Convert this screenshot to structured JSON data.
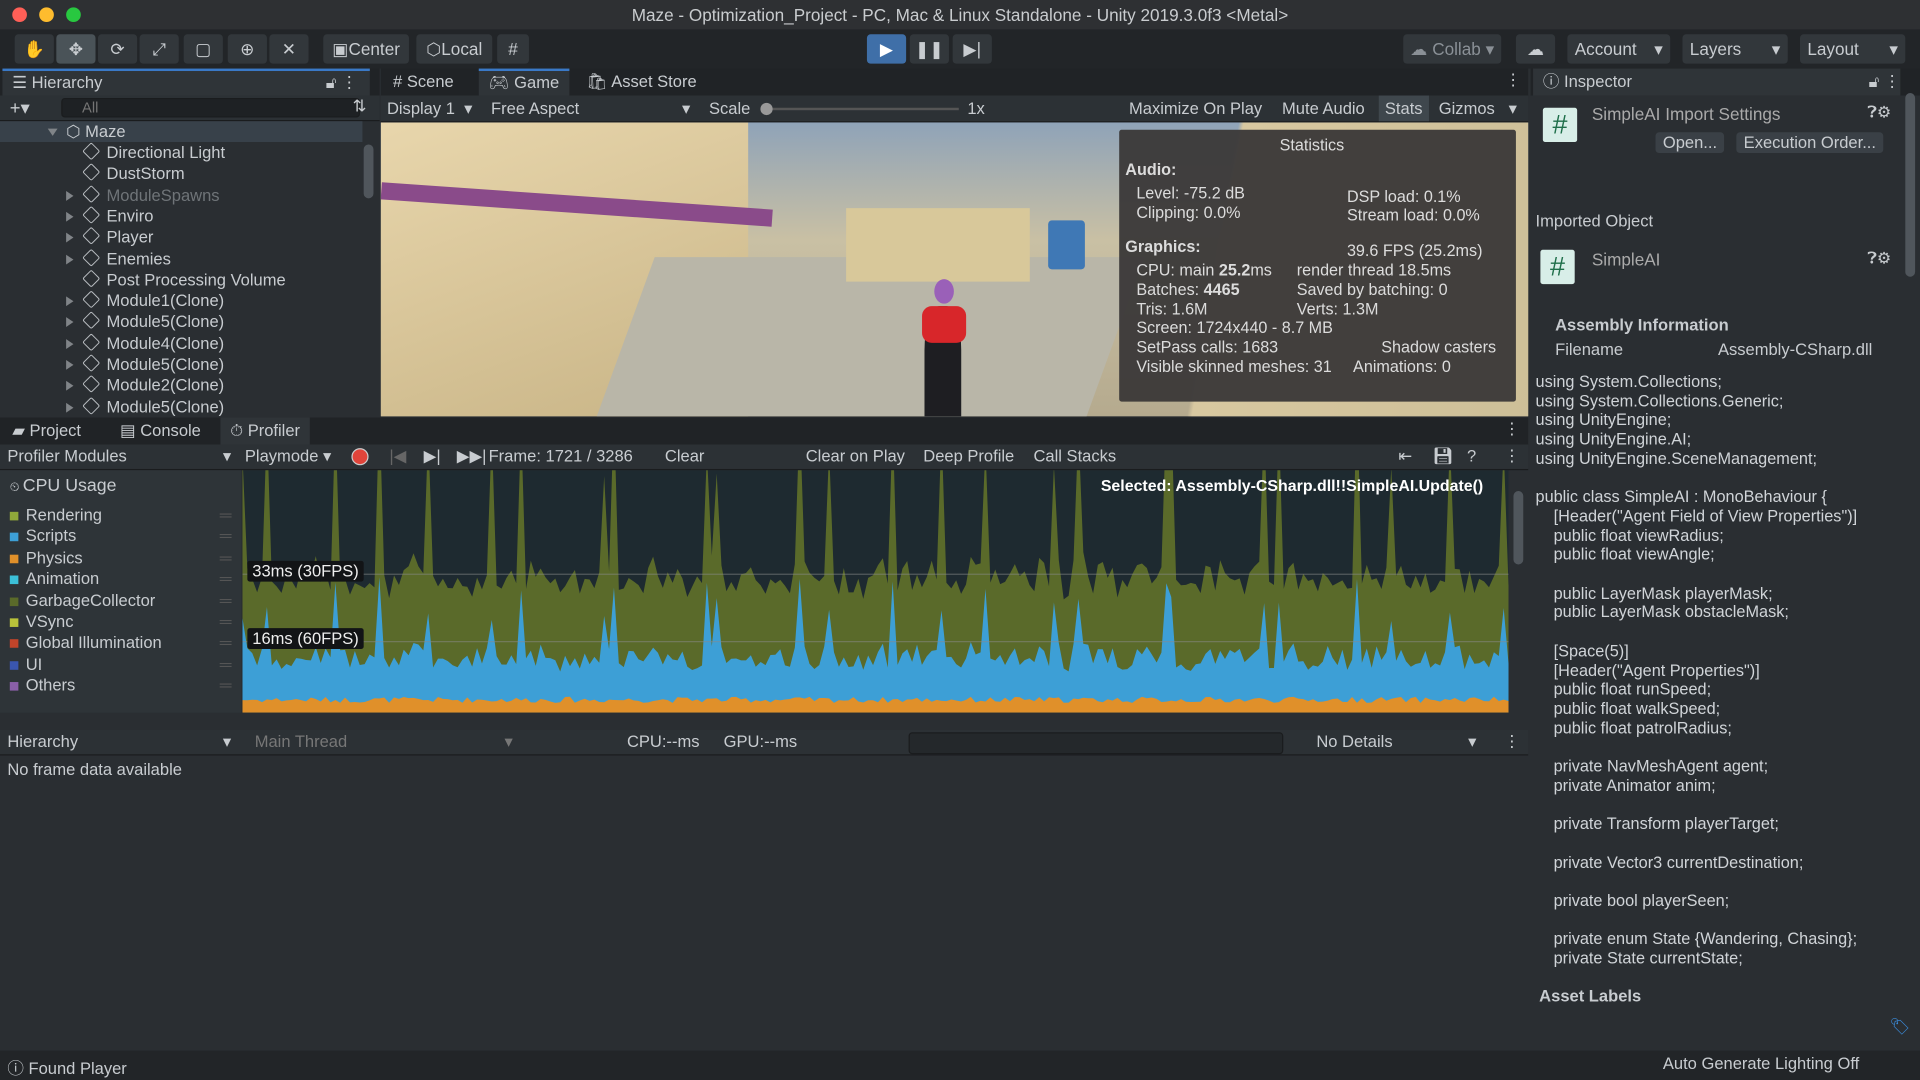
{
  "window": {
    "title": "Maze - Optimization_Project - PC, Mac & Linux Standalone - Unity 2019.3.0f3 <Metal>"
  },
  "toolbar": {
    "tools": [
      "hand-tool",
      "move-tool",
      "rotate-tool",
      "scale-tool",
      "rect-tool",
      "transform-tool",
      "custom-tool"
    ],
    "center": "Center",
    "local": "Local",
    "collab": "Collab",
    "account": "Account",
    "layers": "Layers",
    "layout": "Layout"
  },
  "hierarchy": {
    "title": "Hierarchy",
    "search_placeholder": "All",
    "scene": "Maze",
    "items": [
      {
        "label": "Directional Light",
        "expandable": false,
        "dim": false
      },
      {
        "label": "DustStorm",
        "expandable": false,
        "dim": false
      },
      {
        "label": "ModuleSpawns",
        "expandable": true,
        "dim": true
      },
      {
        "label": "Enviro",
        "expandable": true,
        "dim": false
      },
      {
        "label": "Player",
        "expandable": true,
        "dim": false
      },
      {
        "label": "Enemies",
        "expandable": true,
        "dim": false
      },
      {
        "label": "Post Processing Volume",
        "expandable": false,
        "dim": false
      },
      {
        "label": "Module1(Clone)",
        "expandable": true,
        "dim": false
      },
      {
        "label": "Module5(Clone)",
        "expandable": true,
        "dim": false
      },
      {
        "label": "Module4(Clone)",
        "expandable": true,
        "dim": false
      },
      {
        "label": "Module5(Clone)",
        "expandable": true,
        "dim": false
      },
      {
        "label": "Module2(Clone)",
        "expandable": true,
        "dim": false
      },
      {
        "label": "Module5(Clone)",
        "expandable": true,
        "dim": false
      }
    ]
  },
  "game": {
    "tabs": [
      "Scene",
      "Game",
      "Asset Store"
    ],
    "display": "Display 1",
    "aspect": "Free Aspect",
    "scale_label": "Scale",
    "scale_value": "1x",
    "maximize": "Maximize On Play",
    "mute": "Mute Audio",
    "stats": "Stats",
    "gizmos": "Gizmos"
  },
  "stats": {
    "title": "Statistics",
    "audio": "Audio:",
    "level": "Level: -75.2 dB",
    "clipping": "Clipping: 0.0%",
    "dsp": "DSP load: 0.1%",
    "stream": "Stream load: 0.0%",
    "graphics": "Graphics:",
    "fps": "39.6 FPS (25.2ms)",
    "cpu_label": "CPU: main ",
    "cpu_value": "25.2",
    "cpu_unit": "ms",
    "render_thread": "render thread 18.5ms",
    "batches_label": "Batches: ",
    "batches_value": "4465",
    "saved": "Saved by batching: 0",
    "tris": "Tris: 1.6M",
    "verts": "Verts: 1.3M",
    "screen": "Screen: 1724x440 - 8.7 MB",
    "setpass": "SetPass calls: 1683",
    "shadow": "Shadow casters",
    "skinned": "Visible skinned meshes: 31",
    "animations": "Animations: 0"
  },
  "bottom_tabs": [
    "Project",
    "Console",
    "Profiler"
  ],
  "profiler": {
    "modules": "Profiler Modules",
    "playmode": "Playmode",
    "frame": "Frame: 1721 / 3286",
    "clear": "Clear",
    "clear_on_play": "Clear on Play",
    "deep_profile": "Deep Profile",
    "call_stacks": "Call Stacks",
    "cpu_usage": "CPU Usage",
    "selected": "Selected: Assembly-CSharp.dll!!SimpleAI.Update()",
    "line30": "33ms (30FPS)",
    "line60": "16ms (60FPS)",
    "categories": [
      {
        "name": "Rendering",
        "color": "#8fa83a"
      },
      {
        "name": "Scripts",
        "color": "#3d9fd6"
      },
      {
        "name": "Physics",
        "color": "#e0902a"
      },
      {
        "name": "Animation",
        "color": "#3cc0d8"
      },
      {
        "name": "GarbageCollector",
        "color": "#5a6a2a"
      },
      {
        "name": "VSync",
        "color": "#b9c23a"
      },
      {
        "name": "Global Illumination",
        "color": "#c0442a"
      },
      {
        "name": "UI",
        "color": "#3a56b0"
      },
      {
        "name": "Others",
        "color": "#8a5fa8"
      }
    ],
    "view": "Hierarchy",
    "thread": "Main Thread",
    "cpu": "CPU:--ms",
    "gpu": "GPU:--ms",
    "details": "No Details",
    "empty": "No frame data available"
  },
  "inspector": {
    "title": "Inspector",
    "import_title": "SimpleAI Import Settings",
    "open": "Open...",
    "exec_order": "Execution Order...",
    "imported_object": "Imported Object",
    "object_name": "SimpleAI",
    "assembly_info": "Assembly Information",
    "filename_label": "Filename",
    "filename_value": "Assembly-CSharp.dll",
    "code": [
      "using System.Collections;",
      "using System.Collections.Generic;",
      "using UnityEngine;",
      "using UnityEngine.AI;",
      "using UnityEngine.SceneManagement;",
      "",
      "public class SimpleAI : MonoBehaviour {",
      "    [Header(\"Agent Field of View Properties\")]",
      "    public float viewRadius;",
      "    public float viewAngle;",
      "",
      "    public LayerMask playerMask;",
      "    public LayerMask obstacleMask;",
      "",
      "    [Space(5)]",
      "    [Header(\"Agent Properties\")]",
      "    public float runSpeed;",
      "    public float walkSpeed;",
      "    public float patrolRadius;",
      "",
      "    private NavMeshAgent agent;",
      "    private Animator anim;",
      "",
      "    private Transform playerTarget;",
      "",
      "    private Vector3 currentDestination;",
      "",
      "    private bool playerSeen;",
      "",
      "    private enum State {Wandering, Chasing};",
      "    private State currentState;"
    ],
    "asset_labels": "Asset Labels"
  },
  "status": {
    "message": "Found Player",
    "lighting": "Auto Generate Lighting Off"
  }
}
